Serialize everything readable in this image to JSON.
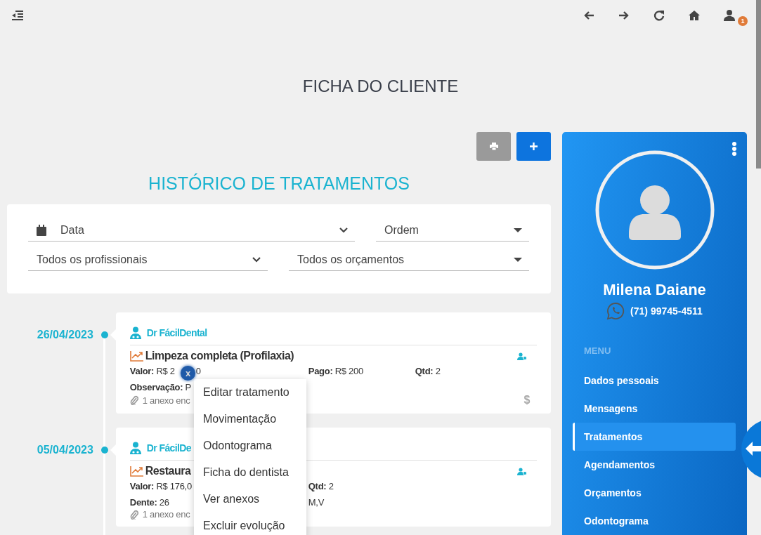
{
  "topbar": {
    "notification_count": "1"
  },
  "page_title": "FICHA DO CLIENTE",
  "history": {
    "title": "HISTÓRICO DE TRATAMENTOS",
    "filters": [
      {
        "kind": "date",
        "label": "Data"
      },
      {
        "kind": "caret",
        "label": "Ordem"
      },
      {
        "kind": "chevron",
        "label": "Todos os profissionais"
      },
      {
        "kind": "caret",
        "label": "Todos os orçamentos"
      }
    ]
  },
  "entries": [
    {
      "date": "26/04/2023",
      "professional": "Dr FácilDental",
      "treatment": "Limpeza completa (Profilaxia)",
      "rows": [
        [
          {
            "label": "Valor:",
            "value": "R$ 2",
            "value_end": "0"
          },
          {
            "label": "Pago:",
            "value": "R$ 200"
          },
          {
            "label": "Qtd:",
            "value": "2"
          }
        ],
        [
          {
            "label": "Observação:",
            "value": "P"
          }
        ]
      ],
      "attachments": "1 anexo enc",
      "payment_icon": "$"
    },
    {
      "date": "05/04/2023",
      "professional": "Dr FácilDe",
      "treatment": "Restaura",
      "rows": [
        [
          {
            "label": "Valor:",
            "value": "R$ 176,0"
          },
          {
            "label": "Qtd:",
            "value": "2"
          }
        ],
        [
          {
            "label": "Dente:",
            "value": "26"
          },
          {
            "value": "M,V"
          }
        ]
      ],
      "attachments": "1 anexo enc"
    }
  ],
  "context_menu": {
    "close": "x",
    "items": [
      "Editar tratamento",
      "Movimentação",
      "Odontograma",
      "Ficha do dentista",
      "Ver anexos",
      "Excluir evolução"
    ]
  },
  "profile": {
    "name": "Milena Daiane",
    "phone": "(71) 99745-4511",
    "menu_heading": "MENU",
    "items": [
      {
        "label": "Dados pessoais",
        "selected": false
      },
      {
        "label": "Mensagens",
        "selected": false
      },
      {
        "label": "Tratamentos",
        "selected": true
      },
      {
        "label": "Agendamentos",
        "selected": false
      },
      {
        "label": "Orçamentos",
        "selected": false
      },
      {
        "label": "Odontograma",
        "selected": false
      }
    ]
  }
}
